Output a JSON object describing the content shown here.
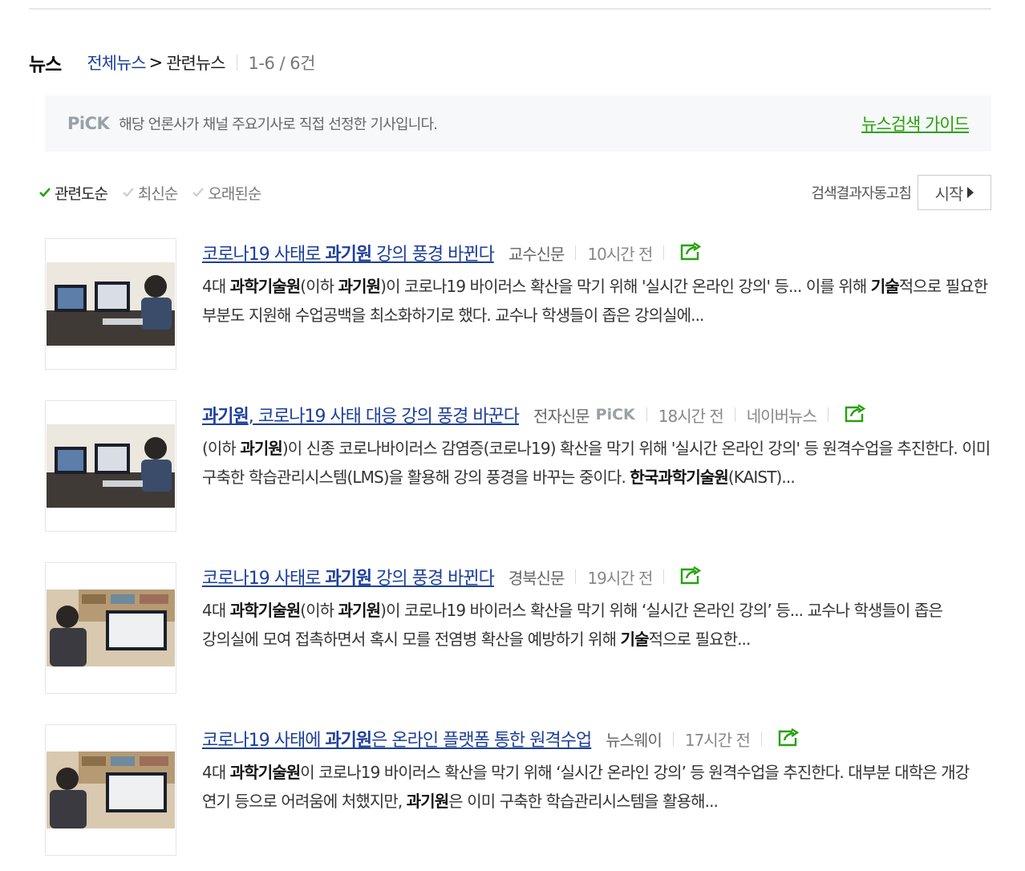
{
  "header": {
    "section": "뉴스",
    "crumb_link": "전체뉴스",
    "crumb_sep": ">",
    "crumb_current": "관련뉴스",
    "count": "1-6 / 6건"
  },
  "pick_notice": {
    "logo": "PiCK",
    "text": "해당 언론사가 채널 주요기사로 직접 선정한 기사입니다.",
    "guide": "뉴스검색 가이드"
  },
  "sort": {
    "options": [
      "관련도순",
      "최신순",
      "오래된순"
    ],
    "active": "관련도순",
    "auto_label": "검색결과자동고침",
    "start_label": "시작"
  },
  "colors": {
    "title_link": "#1d3f9a",
    "guide_green": "#27a20a",
    "check_green": "#27a20a",
    "share_green": "#27a20a"
  },
  "news": [
    {
      "title_parts": [
        {
          "t": "코로나19 사태로 ",
          "b": false
        },
        {
          "t": "과기원",
          "b": true
        },
        {
          "t": " 강의 풍경 바뀐다",
          "b": false
        }
      ],
      "press": "교수신문",
      "pick": "",
      "time": "10시간 전",
      "naver": "",
      "desc_parts": [
        {
          "t": "4대 ",
          "b": false
        },
        {
          "t": "과학기술원",
          "b": true
        },
        {
          "t": "(이하 ",
          "b": false
        },
        {
          "t": "과기원",
          "b": true
        },
        {
          "t": ")이 코로나19 바이러스 확산을 막기 위해 '실시간 온라인 강의' 등... 이를 위해 ",
          "b": false
        },
        {
          "t": "기술",
          "b": true
        },
        {
          "t": "적으로 필요한 부분도 지원해 수업공백을 최소화하기로 했다. 교수나 학생들이 좁은 강의실에...",
          "b": false
        }
      ]
    },
    {
      "title_parts": [
        {
          "t": "과기원",
          "b": true
        },
        {
          "t": ", 코로나19 사태 대응 강의 풍경 바꾼다",
          "b": false
        }
      ],
      "press": "전자신문",
      "pick": "PiCK",
      "time": "18시간 전",
      "naver": "네이버뉴스",
      "desc_parts": [
        {
          "t": "(이하 ",
          "b": false
        },
        {
          "t": "과기원",
          "b": true
        },
        {
          "t": ")이 신종 코로나바이러스 감염증(코로나19) 확산을 막기 위해 '실시간 온라인 강의' 등 원격수업을 추진한다. 이미 구축한 학습관리시스템(LMS)을 활용해 강의 풍경을 바꾸는 중이다. ",
          "b": false
        },
        {
          "t": "한국과학기술원",
          "b": true
        },
        {
          "t": "(KAIST)...",
          "b": false
        }
      ]
    },
    {
      "title_parts": [
        {
          "t": "코로나19 사태로 ",
          "b": false
        },
        {
          "t": "과기원",
          "b": true
        },
        {
          "t": " 강의 풍경 바뀐다",
          "b": false
        }
      ],
      "press": "경북신문",
      "pick": "",
      "time": "19시간 전",
      "naver": "",
      "desc_parts": [
        {
          "t": "4대 ",
          "b": false
        },
        {
          "t": "과학기술원",
          "b": true
        },
        {
          "t": "(이하 ",
          "b": false
        },
        {
          "t": "과기원",
          "b": true
        },
        {
          "t": ")이 코로나19 바이러스 확산을 막기 위해 ‘실시간 온라인 강의’ 등... 교수나 학생들이 좁은 강의실에 모여 접촉하면서 혹시 모를 전염병 확산을 예방하기 위해 ",
          "b": false
        },
        {
          "t": "기술",
          "b": true
        },
        {
          "t": "적으로 필요한...",
          "b": false
        }
      ]
    },
    {
      "title_parts": [
        {
          "t": "코로나19 사태에 ",
          "b": false
        },
        {
          "t": "과기원",
          "b": true
        },
        {
          "t": "은 온라인 플랫폼 통한 원격수업",
          "b": false
        }
      ],
      "press": "뉴스웨이",
      "pick": "",
      "time": "17시간 전",
      "naver": "",
      "desc_parts": [
        {
          "t": "4대 ",
          "b": false
        },
        {
          "t": "과학기술원",
          "b": true
        },
        {
          "t": "이 코로나19 바이러스 확산을 막기 위해 ‘실시간 온라인 강의’ 등 원격수업을 추진한다. 대부분 대학은 개강 연기 등으로 어려움에 처했지만, ",
          "b": false
        },
        {
          "t": "과기원",
          "b": true
        },
        {
          "t": "은 이미 구축한 학습관리시스템을 활용해...",
          "b": false
        }
      ]
    }
  ]
}
